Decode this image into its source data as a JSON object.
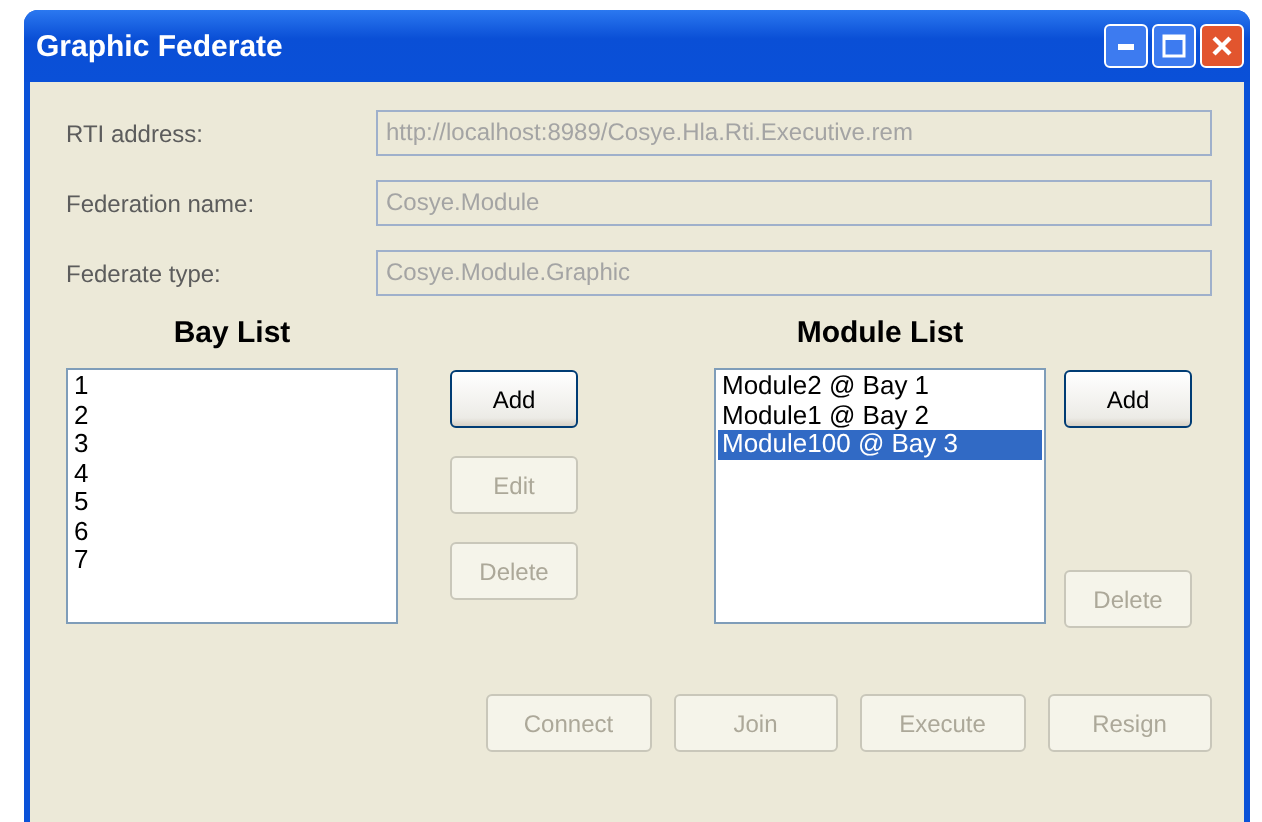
{
  "window": {
    "title": "Graphic Federate"
  },
  "fields": [
    {
      "label": "RTI address:",
      "value": "http://localhost:8989/Cosye.Hla.Rti.Executive.rem",
      "disabled": true
    },
    {
      "label": "Federation name:",
      "value": "Cosye.Module",
      "disabled": true
    },
    {
      "label": "Federate type:",
      "value": "Cosye.Module.Graphic",
      "disabled": true
    }
  ],
  "bay_list": {
    "heading": "Bay List",
    "items": [
      {
        "label": "1",
        "selected": false
      },
      {
        "label": "2",
        "selected": false
      },
      {
        "label": "3",
        "selected": false
      },
      {
        "label": "4",
        "selected": false
      },
      {
        "label": "5",
        "selected": false
      },
      {
        "label": "6",
        "selected": false
      },
      {
        "label": "7",
        "selected": false
      }
    ],
    "buttons": [
      {
        "label": "Add",
        "disabled": false
      },
      {
        "label": "Edit",
        "disabled": true
      },
      {
        "label": "Delete",
        "disabled": true
      }
    ]
  },
  "module_list": {
    "heading": "Module List",
    "items": [
      {
        "label": "Module2 @ Bay 1",
        "selected": false
      },
      {
        "label": "Module1 @ Bay 2",
        "selected": false
      },
      {
        "label": "Module100 @ Bay 3",
        "selected": true
      }
    ],
    "buttons": [
      {
        "label": "Add",
        "disabled": false
      },
      {
        "label": "Delete",
        "disabled": true
      }
    ]
  },
  "actions": [
    {
      "label": "Connect",
      "disabled": true
    },
    {
      "label": "Join",
      "disabled": true
    },
    {
      "label": "Execute",
      "disabled": true
    },
    {
      "label": "Resign",
      "disabled": true
    }
  ]
}
